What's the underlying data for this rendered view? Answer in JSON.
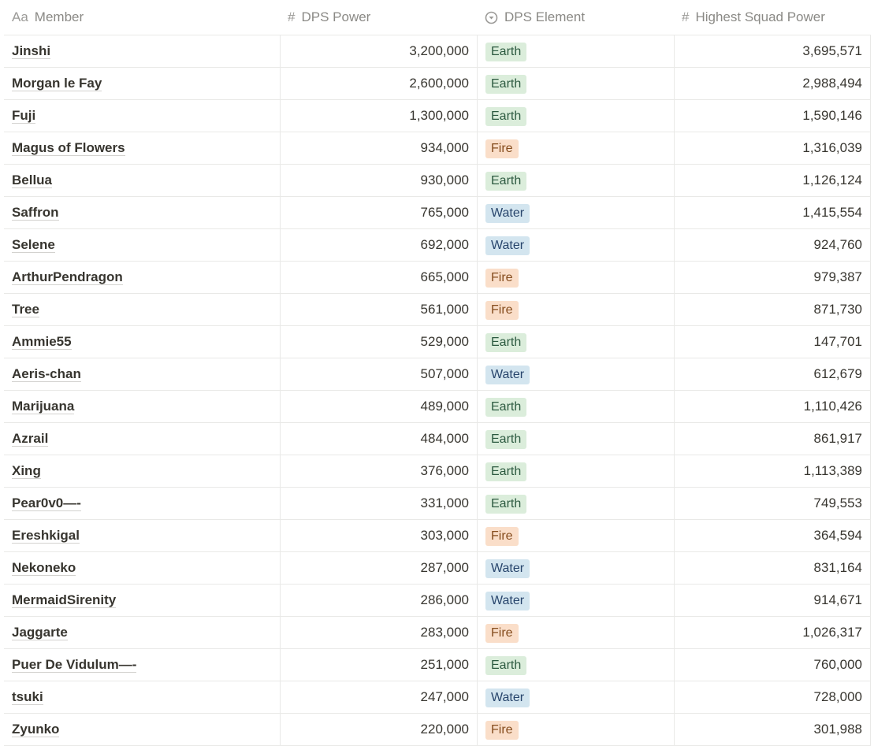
{
  "columns": [
    {
      "icon": "Aa",
      "icon_name": "title-text-icon",
      "label": "Member"
    },
    {
      "icon": "#",
      "icon_name": "number-hash-icon",
      "label": "DPS Power"
    },
    {
      "icon": "▾",
      "icon_name": "select-dropdown-icon",
      "label": "DPS Element"
    },
    {
      "icon": "#",
      "icon_name": "number-hash-icon",
      "label": "Highest Squad Power"
    }
  ],
  "rows": [
    {
      "member": "Jinshi",
      "dps_power": "3,200,000",
      "element": "Earth",
      "squad_power": "3,695,571"
    },
    {
      "member": "Morgan le Fay",
      "dps_power": "2,600,000",
      "element": "Earth",
      "squad_power": "2,988,494"
    },
    {
      "member": "Fuji",
      "dps_power": "1,300,000",
      "element": "Earth",
      "squad_power": "1,590,146"
    },
    {
      "member": "Magus of Flowers",
      "dps_power": "934,000",
      "element": "Fire",
      "squad_power": "1,316,039"
    },
    {
      "member": "Bellua",
      "dps_power": "930,000",
      "element": "Earth",
      "squad_power": "1,126,124"
    },
    {
      "member": "Saffron",
      "dps_power": "765,000",
      "element": "Water",
      "squad_power": "1,415,554"
    },
    {
      "member": "Selene",
      "dps_power": "692,000",
      "element": "Water",
      "squad_power": "924,760"
    },
    {
      "member": "ArthurPendragon",
      "dps_power": "665,000",
      "element": "Fire",
      "squad_power": "979,387"
    },
    {
      "member": "Tree",
      "dps_power": "561,000",
      "element": "Fire",
      "squad_power": "871,730"
    },
    {
      "member": "Ammie55",
      "dps_power": "529,000",
      "element": "Earth",
      "squad_power": "147,701"
    },
    {
      "member": "Aeris-chan",
      "dps_power": "507,000",
      "element": "Water",
      "squad_power": "612,679"
    },
    {
      "member": "Marijuana",
      "dps_power": "489,000",
      "element": "Earth",
      "squad_power": "1,110,426"
    },
    {
      "member": "Azrail",
      "dps_power": "484,000",
      "element": "Earth",
      "squad_power": "861,917"
    },
    {
      "member": "Xing",
      "dps_power": "376,000",
      "element": "Earth",
      "squad_power": "1,113,389"
    },
    {
      "member": "Pear0v0—-",
      "dps_power": "331,000",
      "element": "Earth",
      "squad_power": "749,553"
    },
    {
      "member": "Ereshkigal",
      "dps_power": "303,000",
      "element": "Fire",
      "squad_power": "364,594"
    },
    {
      "member": "Nekoneko",
      "dps_power": "287,000",
      "element": "Water",
      "squad_power": "831,164"
    },
    {
      "member": "MermaidSirenity",
      "dps_power": "286,000",
      "element": "Water",
      "squad_power": "914,671"
    },
    {
      "member": "Jaggarte",
      "dps_power": "283,000",
      "element": "Fire",
      "squad_power": "1,026,317"
    },
    {
      "member": "Puer De Vidulum—-",
      "dps_power": "251,000",
      "element": "Earth",
      "squad_power": "760,000"
    },
    {
      "member": "tsuki",
      "dps_power": "247,000",
      "element": "Water",
      "squad_power": "728,000"
    },
    {
      "member": "Zyunko",
      "dps_power": "220,000",
      "element": "Fire",
      "squad_power": "301,988"
    }
  ],
  "colors": {
    "Earth": "#dbeddb",
    "Fire": "#fadec9",
    "Water": "#d3e5ef"
  }
}
